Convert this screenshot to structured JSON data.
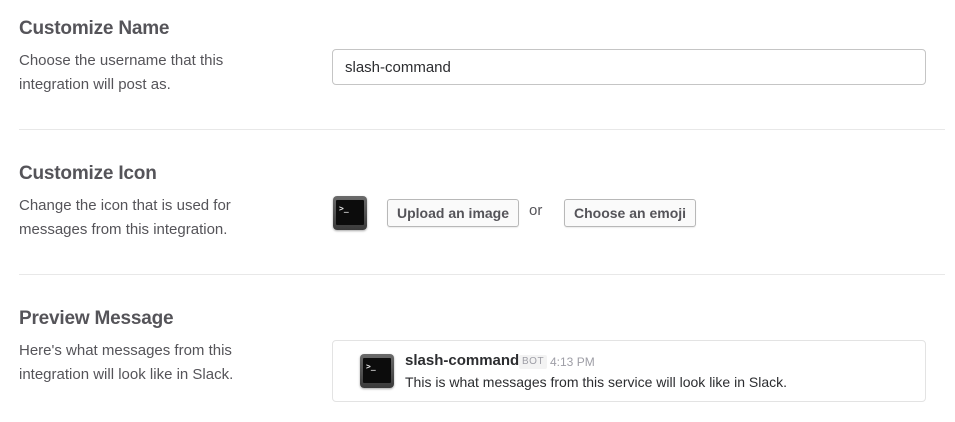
{
  "name_section": {
    "title": "Customize Name",
    "description": "Choose the username that this integration will post as.",
    "input_value": "slash-command"
  },
  "icon_section": {
    "title": "Customize Icon",
    "description": "Change the icon that is used for messages from this integration.",
    "current_icon": "terminal-icon",
    "upload_label": "Upload an image",
    "or_label": "or",
    "emoji_label": "Choose an emoji"
  },
  "preview_section": {
    "title": "Preview Message",
    "description": "Here's what messages from this integration will look like in Slack.",
    "message": {
      "avatar": "terminal-icon",
      "sender": "slash-command",
      "badge": "BOT",
      "time": "4:13 PM",
      "text": "This is what messages from this service will look like in Slack."
    }
  }
}
